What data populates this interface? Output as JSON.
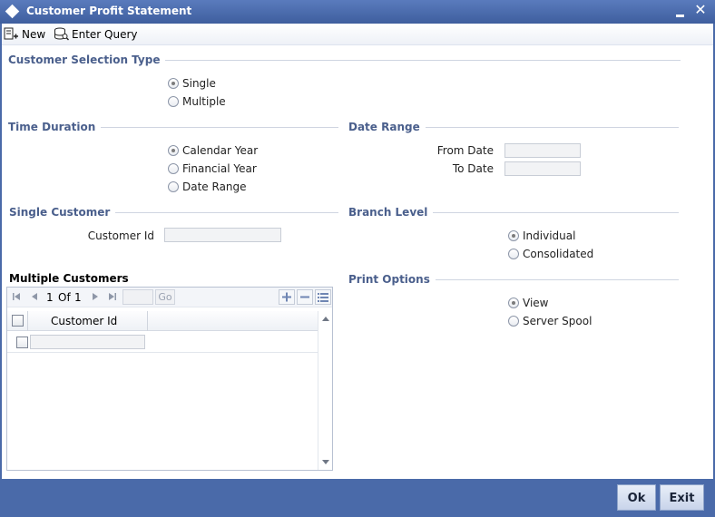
{
  "window": {
    "title": "Customer Profit Statement"
  },
  "toolbar": {
    "new_label": "New",
    "enter_query_label": "Enter Query"
  },
  "customer_selection": {
    "title": "Customer Selection Type",
    "options": [
      {
        "label": "Single",
        "checked": true
      },
      {
        "label": "Multiple",
        "checked": false
      }
    ]
  },
  "time_duration": {
    "title": "Time Duration",
    "options": [
      {
        "label": "Calendar Year",
        "checked": true
      },
      {
        "label": "Financial Year",
        "checked": false
      },
      {
        "label": "Date Range",
        "checked": false
      }
    ]
  },
  "date_range": {
    "title": "Date Range",
    "from_label": "From Date",
    "to_label": "To Date",
    "from_value": "",
    "to_value": ""
  },
  "single_customer": {
    "title": "Single Customer",
    "customer_id_label": "Customer Id",
    "customer_id_value": ""
  },
  "branch_level": {
    "title": "Branch Level",
    "options": [
      {
        "label": "Individual",
        "checked": true
      },
      {
        "label": "Consolidated",
        "checked": false
      }
    ]
  },
  "multiple_customers": {
    "title": "Multiple Customers",
    "page_current": "1",
    "page_of": "Of",
    "page_total": "1",
    "go_label": "Go",
    "column_header": "Customer Id",
    "rows": [
      {
        "customer_id": ""
      }
    ]
  },
  "print_options": {
    "title": "Print Options",
    "options": [
      {
        "label": "View",
        "checked": true
      },
      {
        "label": "Server Spool",
        "checked": false
      }
    ]
  },
  "footer": {
    "ok_label": "Ok",
    "exit_label": "Exit"
  }
}
